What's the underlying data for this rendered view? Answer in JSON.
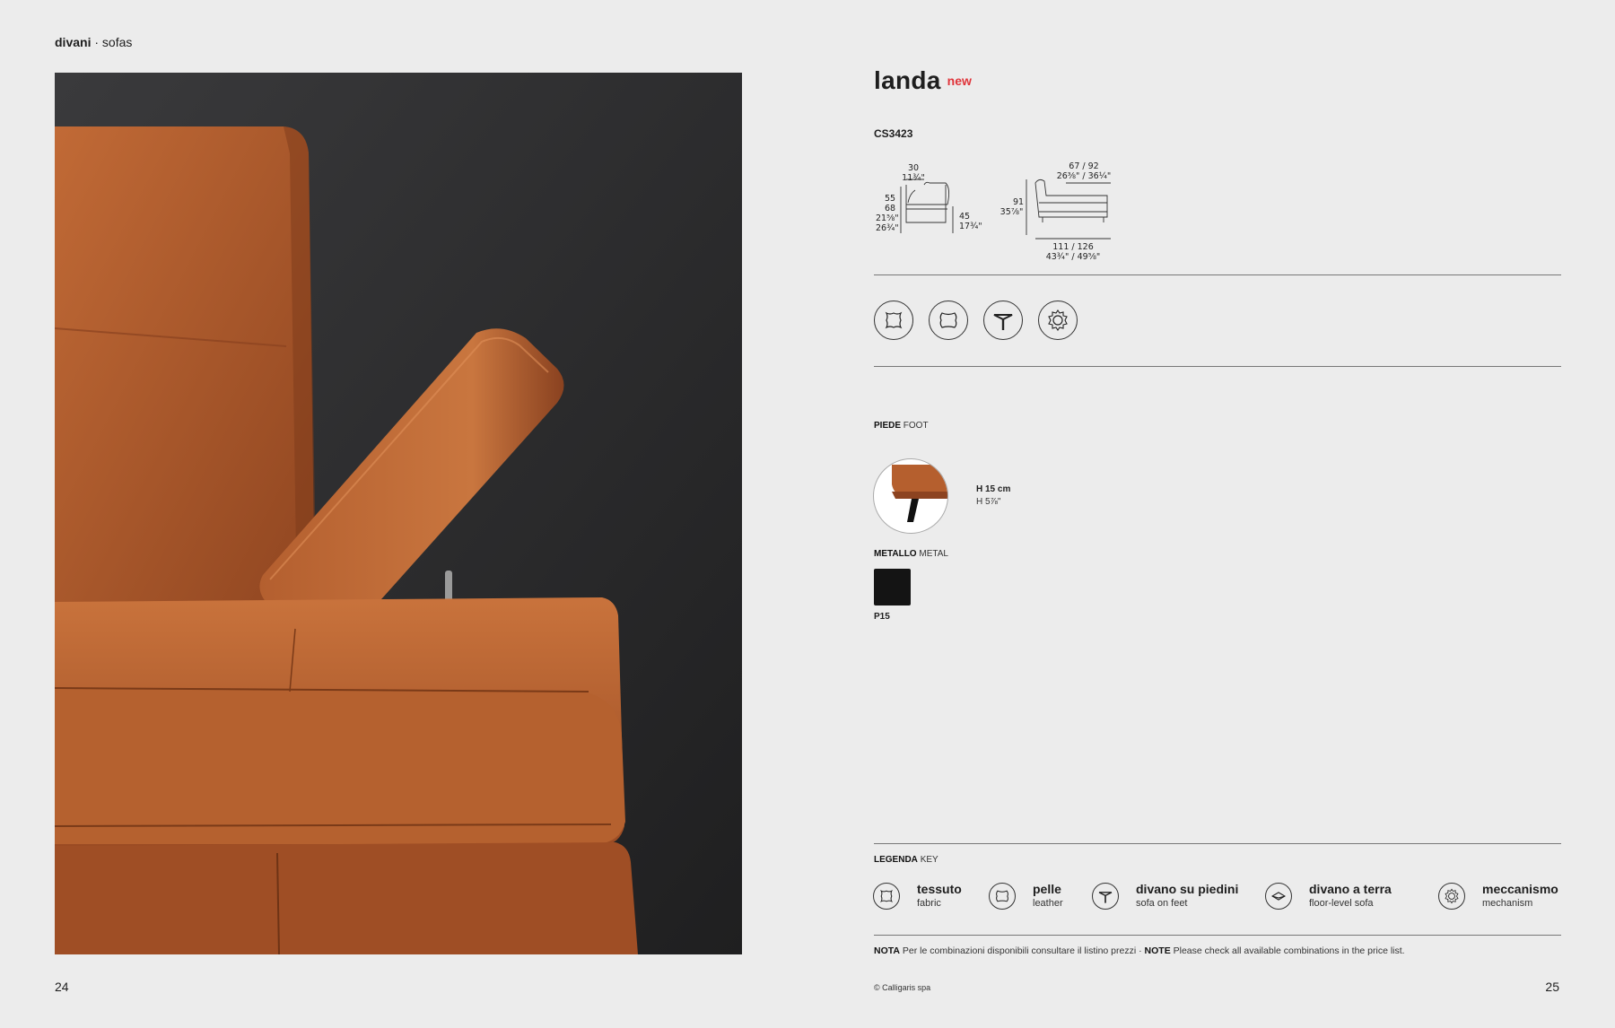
{
  "header": {
    "category": "divani",
    "separator": " · ",
    "subcategory": "sofas"
  },
  "page_left": "24",
  "page_right": "25",
  "product": {
    "name": "landa",
    "badge": "new",
    "code": "CS3423"
  },
  "dimensions": {
    "side": {
      "depth_top_cm": "30",
      "depth_top_in": "11¾\"",
      "h1_cm": "55",
      "h2_cm": "68",
      "h1_in": "21⅝\"",
      "h2_in": "26¾\"",
      "seat_cm": "45",
      "seat_in": "17¾\""
    },
    "front": {
      "width_top_cm": "67 / 92",
      "width_top_in": "26⅜\" / 36¼\"",
      "height_cm": "91",
      "height_in": "35⅞\"",
      "length_cm": "111 / 126",
      "length_in": "43¾\" / 49⅝\""
    }
  },
  "feature_icons": [
    "fabric-icon",
    "leather-icon",
    "sofa-on-feet-icon",
    "mechanism-icon"
  ],
  "foot": {
    "label_it": "PIEDE",
    "label_en": "FOOT",
    "height_cm": "H 15 cm",
    "height_in": "H 5⅞\"",
    "material_it": "METALLO",
    "material_en": "METAL",
    "swatch_code": "P15",
    "swatch_color": "#141414"
  },
  "legend": {
    "label_it": "LEGENDA",
    "label_en": "KEY",
    "items": [
      {
        "icon": "fabric-icon",
        "title": "tessuto",
        "subtitle": "fabric"
      },
      {
        "icon": "leather-icon",
        "title": "pelle",
        "subtitle": "leather"
      },
      {
        "icon": "sofa-on-feet-icon",
        "title": "divano su piedini",
        "subtitle": "sofa on feet"
      },
      {
        "icon": "floor-level-icon",
        "title": "divano a terra",
        "subtitle": "floor-level sofa"
      },
      {
        "icon": "mechanism-icon",
        "title": "meccanismo",
        "subtitle": "mechanism"
      }
    ]
  },
  "note": {
    "label_it": "NOTA",
    "text_it": "Per le combinazioni disponibili consultare il listino prezzi ·",
    "label_en": "NOTE",
    "text_en": "Please check all available combinations in the price list."
  },
  "copyright": "© Calligaris spa",
  "colors": {
    "accent_red": "#e0343a",
    "leather": "#b5622f",
    "background": "#ececec"
  }
}
